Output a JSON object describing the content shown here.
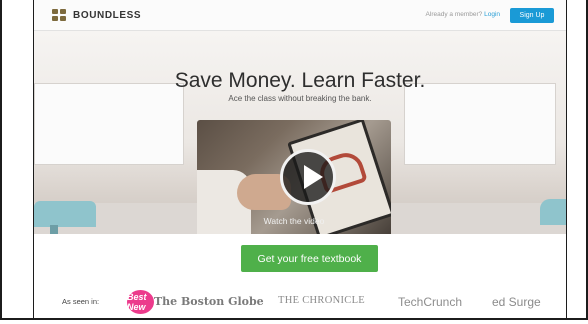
{
  "header": {
    "brand": "BOUNDLESS",
    "member_prompt": "Already a member?",
    "login_label": "Login",
    "signup_label": "Sign Up"
  },
  "hero": {
    "headline": "Save Money. Learn Faster.",
    "subheadline": "Ace the class without breaking the bank.",
    "video_label": "Watch the video"
  },
  "cta": {
    "label": "Get your free textbook"
  },
  "as_seen_in": {
    "label": "As seen in:",
    "publications": [
      "Best New",
      "The Boston Globe",
      "THE CHRONICLE",
      "TechCrunch",
      "ed Surge"
    ]
  },
  "colors": {
    "signup_button": "#1a9ad6",
    "cta_button": "#4fb04a",
    "badge": "#ec3b8c"
  }
}
